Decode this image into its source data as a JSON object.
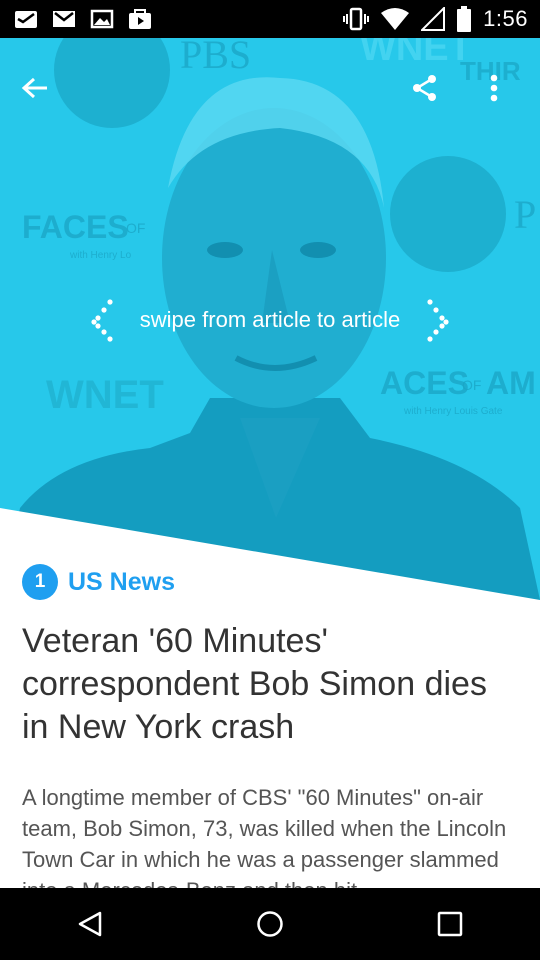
{
  "status_bar": {
    "time": "1:56",
    "left_icons": [
      "inbox-icon",
      "gmail-icon",
      "image-icon",
      "play-store-icon"
    ],
    "right_icons": [
      "vibrate-icon",
      "wifi-icon",
      "signal-icon",
      "battery-icon"
    ]
  },
  "hero": {
    "swipe_hint": "swipe from article to article",
    "background_words": {
      "pbs_top": "PBS",
      "faces_left": "FACES",
      "of_left": "OF",
      "henry_left": "with Henry Lo",
      "wnet_left": "WNET",
      "aces_right": "ACES",
      "of_right": "OF",
      "am_right": "AM",
      "henry_right": "with Henry Louis Gate",
      "wnet_top_right": "WNET",
      "thir_top_right": "THIR",
      "p_right": "P"
    },
    "tint_color": "#27c8ea"
  },
  "article": {
    "section_number": "1",
    "section_name": "US News",
    "title": "Veteran '60 Minutes' correspondent Bob Simon dies in New York crash",
    "body": "A longtime member of CBS' \"60 Minutes\" on-air team, Bob Simon, 73, was killed when the Lincoln Town Car in which he was a passenger slammed into a Mercedes-Benz and then hit"
  },
  "colors": {
    "accent": "#1f9ff0",
    "title_text": "#333333",
    "body_text": "#555555"
  }
}
